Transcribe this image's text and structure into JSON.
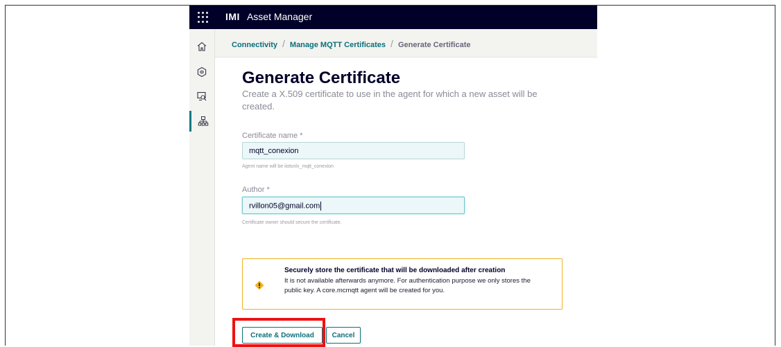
{
  "header": {
    "company": "IMI",
    "app_title": "Asset Manager"
  },
  "sidebar": {
    "items": [
      {
        "icon": "home-icon"
      },
      {
        "icon": "connectivity-icon"
      },
      {
        "icon": "monitor-icon"
      },
      {
        "icon": "hierarchy-icon",
        "active": true
      }
    ]
  },
  "breadcrumb": {
    "items": [
      "Connectivity",
      "Manage MQTT Certificates",
      "Generate Certificate"
    ],
    "separator": "/"
  },
  "page": {
    "title": "Generate Certificate",
    "description": "Create a X.509 certificate to use in the agent for which a new asset will be created."
  },
  "form": {
    "certificate_name": {
      "label": "Certificate name *",
      "value": "mqtt_conexion",
      "hint": "Agent name will be iiotsnlx_mqtt_conexion"
    },
    "author": {
      "label": "Author *",
      "value": "rvillon05@gmail.com",
      "hint": "Certificate owner should secure the certificate."
    }
  },
  "warning": {
    "title": "Securely store the certificate that will be downloaded after creation",
    "text": "It is not available afterwards anymore. For authentication purpose we only stores the public key. A core.mcmqtt agent will be created for you.",
    "icon": "warning-diamond-icon",
    "color": "#f0b020"
  },
  "actions": {
    "create_label": "Create & Download",
    "cancel_label": "Cancel"
  },
  "colors": {
    "topbar": "#000028",
    "accent": "#0a6f7a",
    "highlight": "#ee1111"
  }
}
